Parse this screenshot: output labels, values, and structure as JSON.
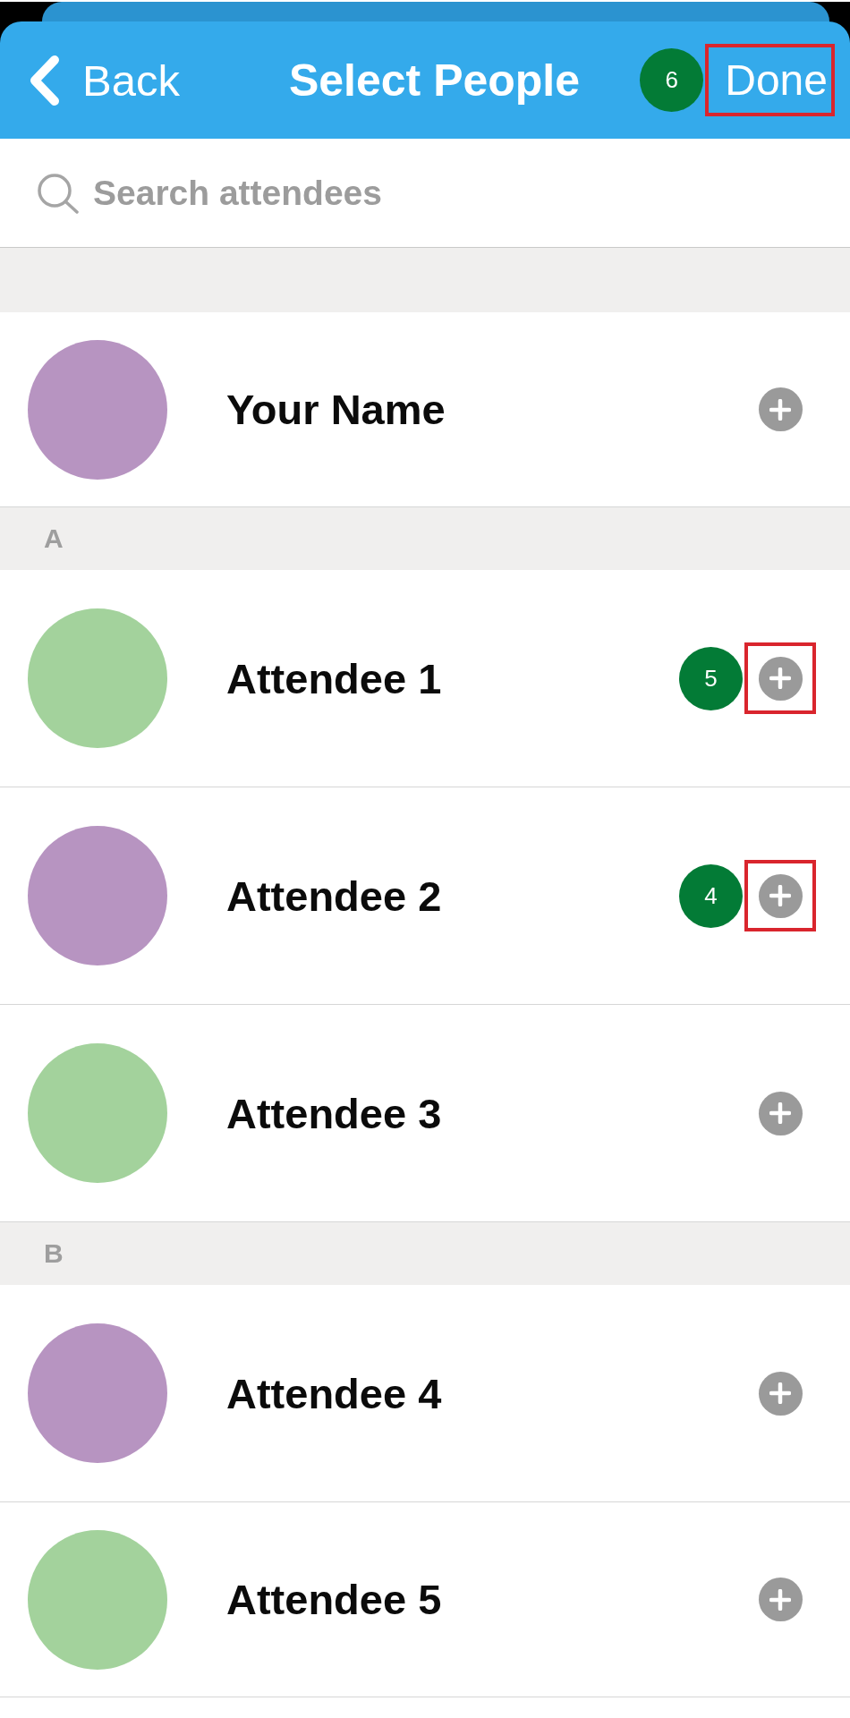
{
  "header": {
    "back": {
      "label": "Back"
    },
    "title": "Select People",
    "done": {
      "label": "Done",
      "highlighted": true,
      "marker": "6"
    }
  },
  "search": {
    "placeholder": "Search attendees"
  },
  "sections": [
    {
      "people": [
        {
          "name": "Your Name",
          "color": "#b794c1",
          "highlighted": false
        }
      ]
    },
    {
      "letter": "A",
      "people": [
        {
          "name": "Attendee 1",
          "color": "#a3d29c",
          "highlighted": true,
          "marker": "5"
        },
        {
          "name": "Attendee 2",
          "color": "#b794c1",
          "highlighted": true,
          "marker": "4"
        },
        {
          "name": "Attendee 3",
          "color": "#a3d29c",
          "highlighted": false
        }
      ]
    },
    {
      "letter": "B",
      "people": [
        {
          "name": "Attendee 4",
          "color": "#b794c1",
          "highlighted": false
        },
        {
          "name": "Attendee 5",
          "color": "#a3d29c",
          "highlighted": false
        }
      ]
    }
  ]
}
